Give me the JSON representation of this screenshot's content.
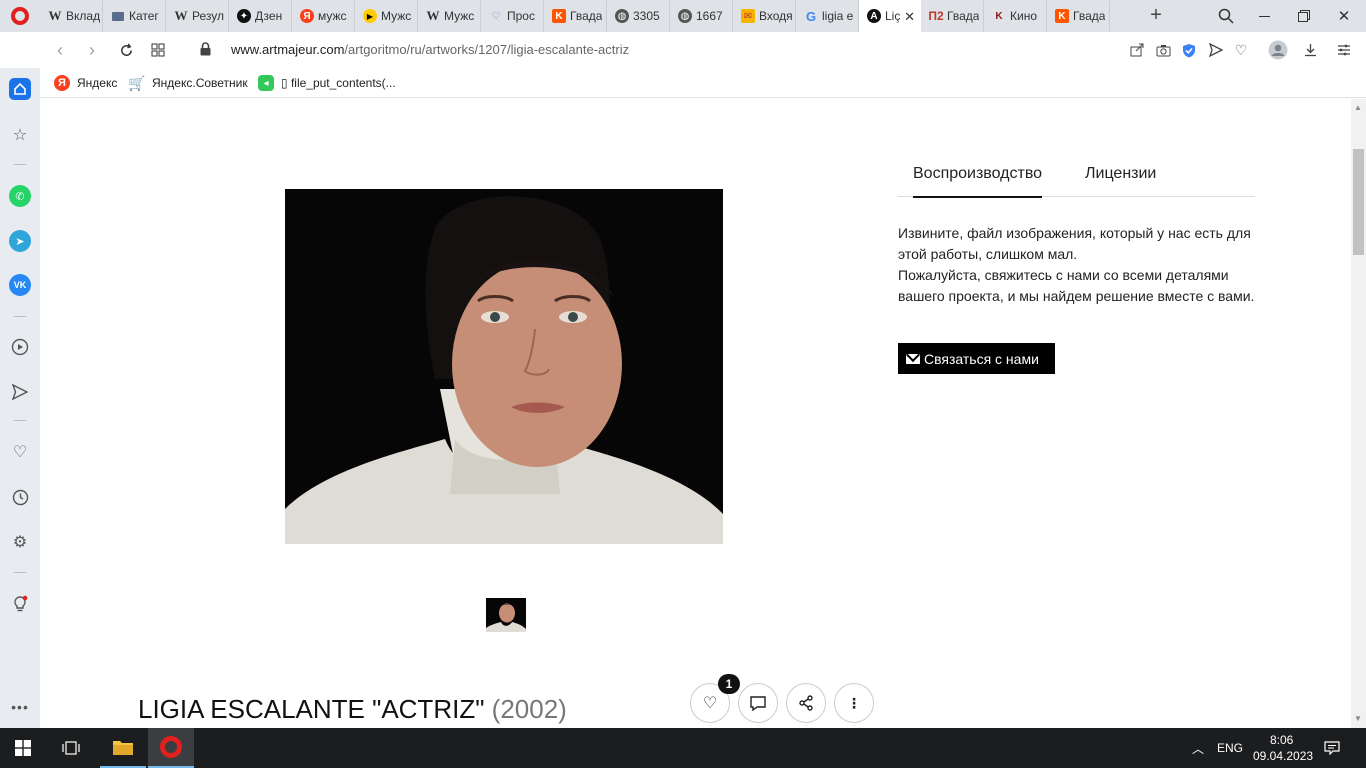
{
  "browser": {
    "tabs": [
      {
        "label": "Вклад",
        "icon": "wikipedia-icon"
      },
      {
        "label": "Катег",
        "icon": "monitor-icon"
      },
      {
        "label": "Резул",
        "icon": "wikipedia-icon"
      },
      {
        "label": "Дзен",
        "icon": "dzen-icon"
      },
      {
        "label": "мужс",
        "icon": "yandex-icon"
      },
      {
        "label": "Мужс",
        "icon": "play-icon"
      },
      {
        "label": "Мужс",
        "icon": "wikipedia-icon"
      },
      {
        "label": "Прос",
        "icon": "heart-icon"
      },
      {
        "label": "Гвада",
        "icon": "kinopoisk-icon"
      },
      {
        "label": "3305",
        "icon": "globe-icon"
      },
      {
        "label": "1667",
        "icon": "globe-icon"
      },
      {
        "label": "Входя",
        "icon": "mail-icon"
      },
      {
        "label": "ligia e",
        "icon": "google-icon"
      },
      {
        "label": "Liç",
        "icon": "artmajeur-icon",
        "active": true
      },
      {
        "label": "Гвада",
        "icon": "m2-icon"
      },
      {
        "label": "Кино",
        "icon": "kino-icon"
      },
      {
        "label": "Гвада",
        "icon": "kinopoisk-icon"
      }
    ],
    "url_domain": "www.artmajeur.com",
    "url_path": "/artgoritmo/ru/artworks/1207/ligia-escalante-actriz",
    "bookmarks": [
      {
        "label": "Яндекс",
        "icon": "yandex-icon"
      },
      {
        "label": "Яндекс.Советник",
        "icon": "cart-icon"
      },
      {
        "label": "▯ file_put_contents(...",
        "icon": "back-arrow-icon"
      }
    ]
  },
  "artwork": {
    "title": "LIGIA ESCALANTE \"ACTRIZ\"",
    "year": "(2002)",
    "likes": "1"
  },
  "panel": {
    "tabs": [
      "Воспроизводство",
      "Лицензии"
    ],
    "message_1": "Извините, файл изображения, который у нас есть для этой работы, слишком мал.",
    "message_2": "Пожалуйста, свяжитесь с нами со всеми деталями вашего проекта, и мы найдем решение вместе с вами.",
    "contact_button": "Связаться с нами"
  },
  "taskbar": {
    "lang": "ENG",
    "time": "8:06",
    "date": "09.04.2023"
  }
}
